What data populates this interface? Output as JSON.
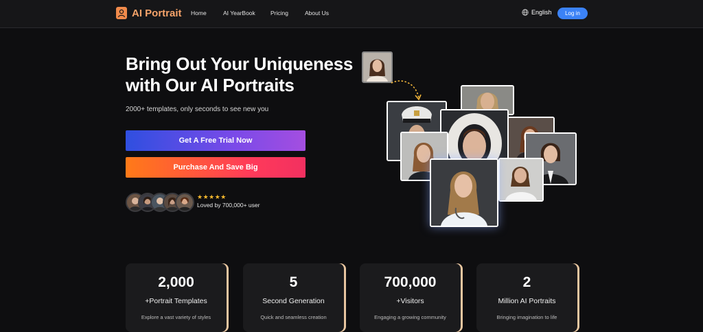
{
  "header": {
    "brand": "AI Portrait",
    "nav": [
      "Home",
      "AI YearBook",
      "Pricing",
      "About Us"
    ],
    "language": "English",
    "login_label": "Log in"
  },
  "hero": {
    "title_line1": "Bring Out Your Uniqueness",
    "title_line2": "with Our AI Portraits",
    "subtitle": "2000+ templates, only seconds to see new you",
    "trial_button": "Get A Free Trial Now",
    "purchase_button": "Purchase And Save Big",
    "rating_stars": "★★★★★",
    "loved_text": "Loved by 700,000+ user"
  },
  "colors": {
    "brand": "#f5a36a",
    "login": "#3b82f6",
    "star": "#f5b82e"
  },
  "stats": [
    {
      "number": "2,000",
      "label": "+Portrait Templates",
      "desc": "Explore a vast variety of styles"
    },
    {
      "number": "5",
      "label": "Second Generation",
      "desc": "Quick and seamless creation"
    },
    {
      "number": "700,000",
      "label": "+Visitors",
      "desc": "Engaging a growing community"
    },
    {
      "number": "2",
      "label": "Million AI Portraits",
      "desc": "Bringing imagination to life"
    }
  ]
}
